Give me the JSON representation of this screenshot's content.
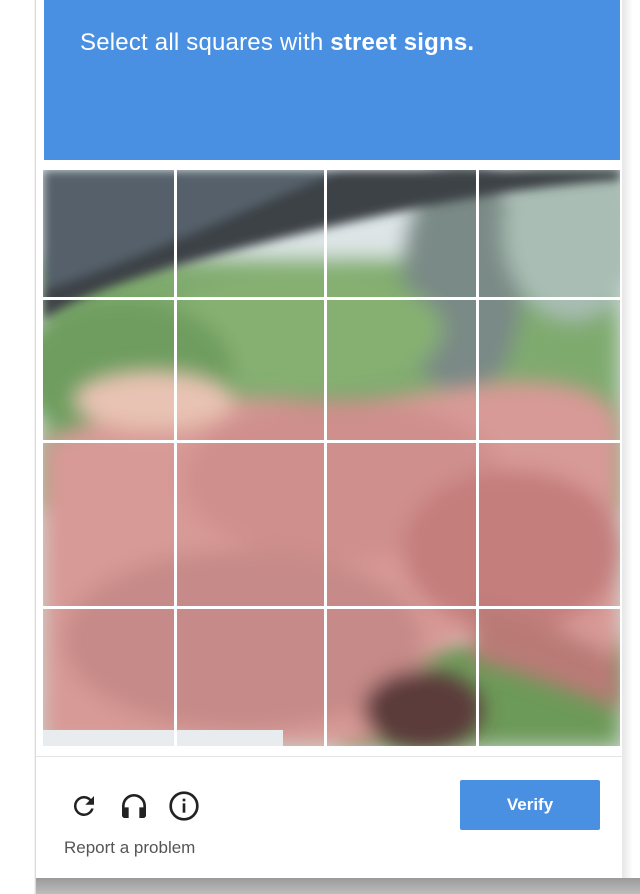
{
  "header": {
    "prompt_prefix": "Select all squares with",
    "prompt_target": "street signs."
  },
  "grid": {
    "rows": 4,
    "cols": 4
  },
  "footer": {
    "icons": [
      "reload-icon",
      "headphones-icon",
      "info-icon"
    ],
    "verify_label": "Verify",
    "report_label": "Report a problem"
  },
  "colors": {
    "accent": "#4a90e2",
    "header_text": "#ffffff"
  }
}
